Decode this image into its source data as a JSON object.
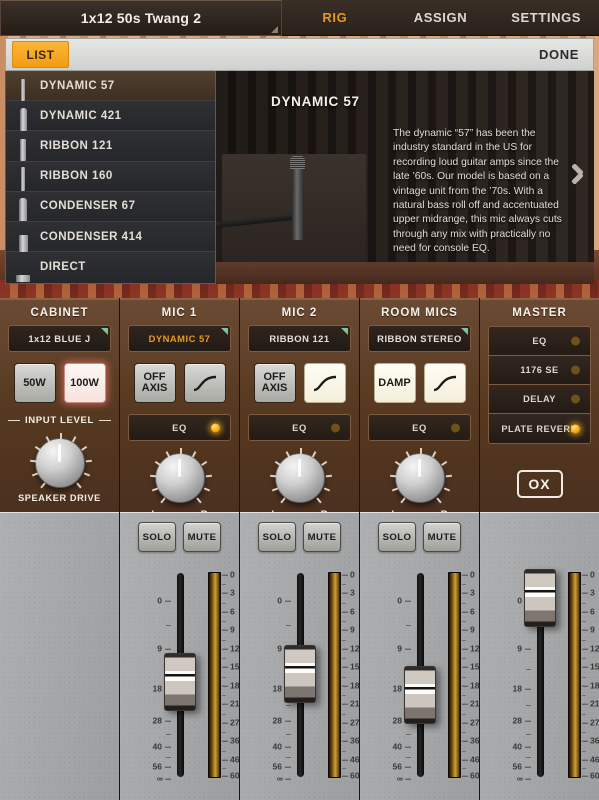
{
  "header": {
    "preset_name": "1x12 50s Twang 2",
    "tabs": [
      {
        "label": "RIG",
        "active": true
      },
      {
        "label": "ASSIGN",
        "active": false
      },
      {
        "label": "SETTINGS",
        "active": false
      }
    ],
    "active_tab_color": "#e79a1e"
  },
  "toolbar": {
    "list_label": "LIST",
    "done_label": "DONE",
    "list_button_color": "#f5a623"
  },
  "mic_list": {
    "items": [
      {
        "label": "DYNAMIC 57",
        "icon": "microphone-icon",
        "selected": true
      },
      {
        "label": "DYNAMIC 421",
        "icon": "microphone-icon",
        "selected": false
      },
      {
        "label": "RIBBON 121",
        "icon": "microphone-icon",
        "selected": false
      },
      {
        "label": "RIBBON 160",
        "icon": "microphone-icon",
        "selected": false
      },
      {
        "label": "CONDENSER 67",
        "icon": "microphone-icon",
        "selected": false
      },
      {
        "label": "CONDENSER 414",
        "icon": "microphone-icon",
        "selected": false
      },
      {
        "label": "DIRECT",
        "icon": "direct-box-icon",
        "selected": false
      }
    ]
  },
  "detail": {
    "title": "DYNAMIC 57",
    "description": "The dynamic “57” has been the industry standard in the US for recording loud guitar amps since the late ’60s. Our model is based on a vintage unit from the ’70s. With a natural bass roll off and accentuated upper midrange, this mic always cuts through any mix with practically no need for console EQ.",
    "next_icon": "chevron-right-icon"
  },
  "strips": [
    {
      "title": "CABINET",
      "selector": {
        "value": "1x12 BLUE J",
        "active": false
      },
      "buttons": [
        {
          "label": "50W",
          "state": "off",
          "type": "text"
        },
        {
          "label": "100W",
          "state": "on",
          "type": "text"
        }
      ],
      "input_level_label": "INPUT LEVEL",
      "knob": {
        "label": "SPEAKER DRIVE",
        "value_deg": 0
      },
      "has_eq": false,
      "has_fader": false,
      "has_solo_mute": false
    },
    {
      "title": "MIC 1",
      "selector": {
        "value": "DYNAMIC 57",
        "active": true
      },
      "buttons": [
        {
          "label": "OFF AXIS",
          "state": "off",
          "type": "text"
        },
        {
          "label": "",
          "state": "off",
          "type": "slope"
        }
      ],
      "eq": {
        "label": "EQ",
        "led": "on"
      },
      "knob": {
        "label": "",
        "lr": [
          "L",
          "R"
        ],
        "value_deg": 0
      },
      "has_eq": true,
      "has_fader": true,
      "has_solo_mute": true,
      "solo_label": "SOLO",
      "mute_label": "MUTE",
      "fader_position_db": 13
    },
    {
      "title": "MIC 2",
      "selector": {
        "value": "RIBBON 121",
        "active": false
      },
      "buttons": [
        {
          "label": "OFF AXIS",
          "state": "off",
          "type": "text"
        },
        {
          "label": "",
          "state": "lit",
          "type": "slope"
        }
      ],
      "eq": {
        "label": "EQ",
        "led": "off"
      },
      "knob": {
        "label": "",
        "lr": [
          "L",
          "R"
        ],
        "value_deg": 0
      },
      "has_eq": true,
      "has_fader": true,
      "has_solo_mute": true,
      "solo_label": "SOLO",
      "mute_label": "MUTE",
      "fader_position_db": 11
    },
    {
      "title": "ROOM MICS",
      "selector": {
        "value": "RIBBON STEREO",
        "active": false
      },
      "buttons": [
        {
          "label": "DAMP",
          "state": "lit",
          "type": "text"
        },
        {
          "label": "",
          "state": "lit",
          "type": "slope"
        }
      ],
      "eq": {
        "label": "EQ",
        "led": "off"
      },
      "knob": {
        "label": "",
        "lr": [
          "L",
          "R"
        ],
        "value_deg": 0
      },
      "has_eq": true,
      "has_fader": true,
      "has_solo_mute": true,
      "solo_label": "SOLO",
      "mute_label": "MUTE",
      "fader_position_db": 16
    },
    {
      "title": "MASTER",
      "fx": [
        {
          "label": "EQ",
          "led": "off"
        },
        {
          "label": "1176 SE",
          "led": "off"
        },
        {
          "label": "DELAY",
          "led": "off"
        },
        {
          "label": "PLATE REVERB",
          "led": "on"
        }
      ],
      "logo": "OX",
      "has_eq": false,
      "has_fader": true,
      "has_solo_mute": false,
      "fader_position_db": 2
    }
  ],
  "fader_scale": {
    "labels": [
      "0",
      "9",
      "18",
      "28",
      "40",
      "56",
      "∞"
    ],
    "unit": "dB"
  },
  "meter_scale": {
    "labels": [
      "0",
      "3",
      "6",
      "9",
      "12",
      "15",
      "18",
      "21",
      "27",
      "36",
      "46",
      "60"
    ],
    "unit": "dB"
  },
  "colors": {
    "accent_amber": "#e89a22",
    "led_on": "#f5a60d",
    "panel_brown": "#55381f",
    "fader_panel_gray": "#a9abad",
    "meter_amber": "#caa33a"
  }
}
